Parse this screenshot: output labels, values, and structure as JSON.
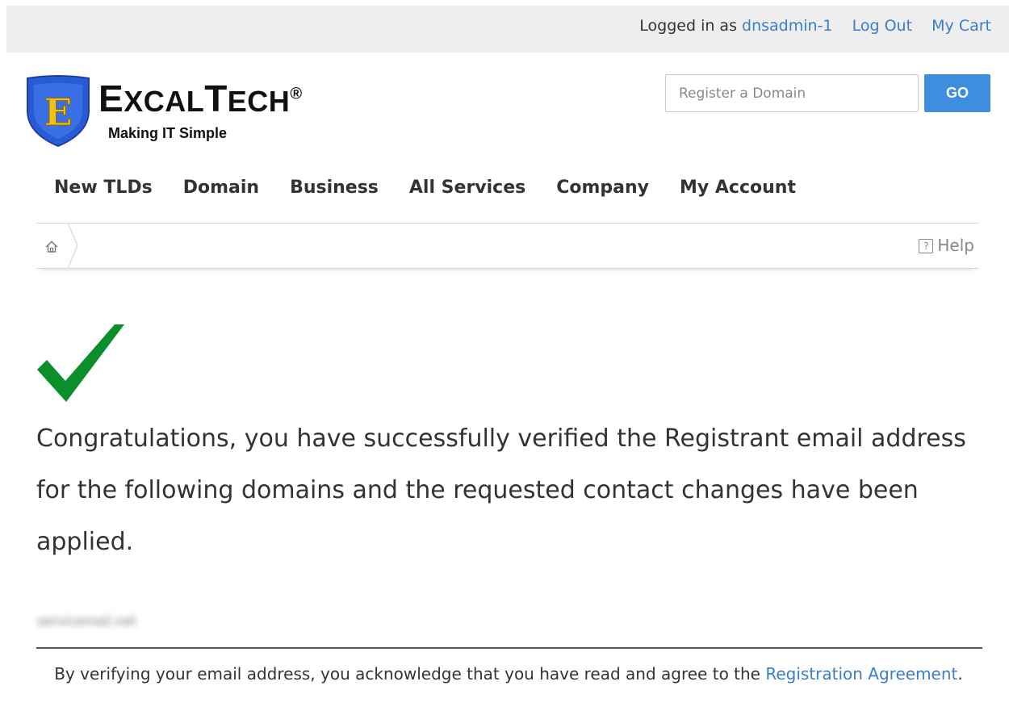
{
  "topbar": {
    "logged_in_prefix": "Logged in as",
    "username": "dnsadmin-1",
    "logout": "Log Out",
    "cart": "My Cart"
  },
  "logo": {
    "brand_first_big": "E",
    "brand_first_small": "XCAL",
    "brand_second_big": "T",
    "brand_second_small": "ECH",
    "registered": "®",
    "tagline": "Making IT Simple",
    "shield_letter": "E"
  },
  "search": {
    "placeholder": "Register a Domain",
    "value": "",
    "go_label": "GO"
  },
  "nav": {
    "items": [
      {
        "label": "New TLDs"
      },
      {
        "label": "Domain"
      },
      {
        "label": "Business"
      },
      {
        "label": "All Services"
      },
      {
        "label": "Company"
      },
      {
        "label": "My Account"
      }
    ]
  },
  "breadcrumb": {
    "help_icon_text": "?",
    "help_label": "Help"
  },
  "main": {
    "message": "Congratulations, you have successfully verified the Registrant email address for the following domains and the requested contact changes have been applied.",
    "domain": "servicemail.net",
    "agreement_text": "By verifying your email address, you acknowledge that you have read and agree to the",
    "agreement_link": "Registration Agreement",
    "agreement_end": "."
  },
  "colors": {
    "link": "#3a7dc9",
    "go_button": "#3d8ede",
    "check": "#0a8f2a",
    "shield": "#2a5bd7"
  }
}
